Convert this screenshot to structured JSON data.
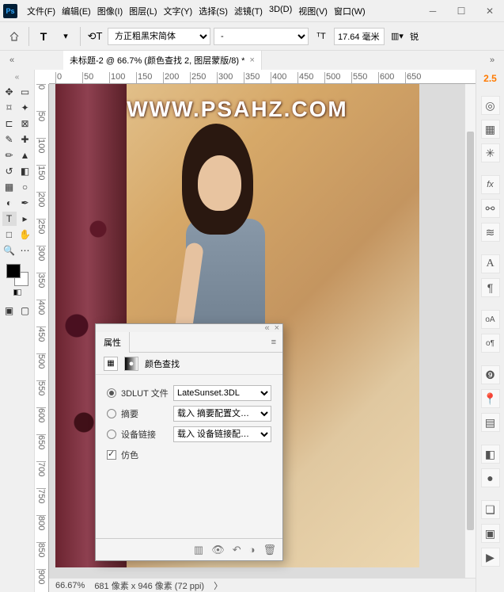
{
  "menubar": {
    "file": "文件(F)",
    "edit": "编辑(E)",
    "image": "图像(I)",
    "layer": "图层(L)",
    "type": "文字(Y)",
    "select": "选择(S)",
    "filter": "滤镜(T)",
    "threeD": "3D(D)",
    "view": "视图(V)",
    "window": "窗口(W)"
  },
  "options": {
    "font": "方正粗黑宋简体",
    "style": "-",
    "size": "17.64 毫米",
    "sharp": "锐"
  },
  "tab": {
    "label": "未标题-2 @ 66.7% (颜色查找 2, 图层蒙版/8) *"
  },
  "ruler_marks": [
    "0",
    "50",
    "100",
    "150",
    "200",
    "250",
    "300",
    "350",
    "400",
    "450",
    "500",
    "550",
    "600",
    "650"
  ],
  "ruler_marks_v": [
    "0",
    "50",
    "100",
    "150",
    "200",
    "250",
    "300",
    "350",
    "400",
    "450",
    "500",
    "550",
    "600",
    "650",
    "700",
    "750",
    "800",
    "850",
    "900"
  ],
  "watermark": "WWW.PSAHZ.COM",
  "status": {
    "zoom": "66.67%",
    "dims": "681 像素 x 946 像素 (72 ppi)"
  },
  "brush": "2.5",
  "props": {
    "tab": "属性",
    "title": "颜色查找",
    "rows": {
      "lut": "3DLUT 文件",
      "lut_val": "LateSunset.3DL",
      "abstract": "摘要",
      "abstract_val": "载入 摘要配置文…",
      "device": "设备链接",
      "device_val": "载入 设备链接配…",
      "dither": "仿色"
    }
  }
}
